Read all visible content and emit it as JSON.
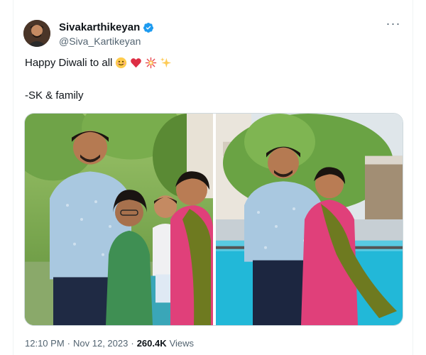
{
  "tweet": {
    "author": {
      "display_name": "Sivakarthikeyan",
      "handle": "@Siva_Kartikeyan",
      "verified": true
    },
    "more_label": "···",
    "text_line1": "Happy Diwali to all",
    "emojis": [
      "smiling-face-icon",
      "red-heart-icon",
      "sparkler-icon",
      "sparkles-icon"
    ],
    "text_line2": "-SK & family",
    "media": [
      {
        "name": "family-photo-1"
      },
      {
        "name": "family-photo-2"
      }
    ],
    "time": "12:10 PM",
    "separator": "·",
    "date": "Nov 12, 2023",
    "views_count": "260.4K",
    "views_label": "Views"
  },
  "colors": {
    "text": "#0f1419",
    "secondary": "#536471",
    "verified": "#1d9bf0",
    "border": "#cfd9de"
  }
}
